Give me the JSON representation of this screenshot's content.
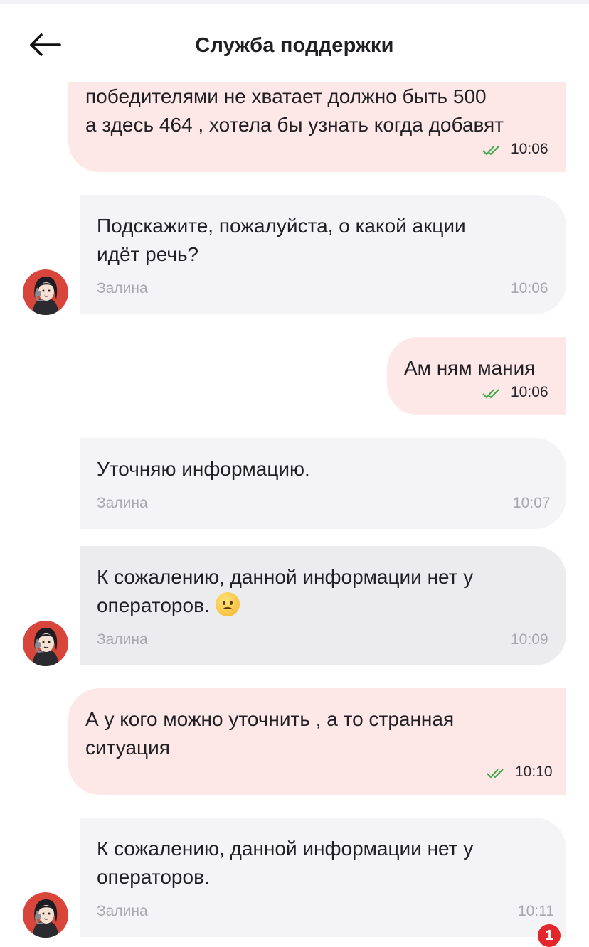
{
  "header": {
    "title": "Служба поддержки",
    "back_icon": "arrow-left-icon"
  },
  "messages": [
    {
      "direction": "out",
      "text": "победителями не хватает должно быть 500\nа здесь 464 , хотела бы узнать когда добавят",
      "time": "10:06",
      "status_icon": "double-check-icon"
    },
    {
      "direction": "in",
      "text": "Подскажите, пожалуйста, о какой акции\nидёт речь?",
      "sender": "Залина",
      "time": "10:06",
      "avatar": "operator-avatar-icon"
    },
    {
      "direction": "out",
      "text": "Ам ням мания",
      "time": "10:06",
      "status_icon": "double-check-icon"
    },
    {
      "direction": "in",
      "text": "Уточняю информацию.",
      "sender": "Залина",
      "time": "10:07"
    },
    {
      "direction": "in",
      "text": "К сожалению, данной информации нет у\nоператоров.",
      "emoji": "worried-face-emoji",
      "sender": "Залина",
      "time": "10:09",
      "avatar": "operator-avatar-icon"
    },
    {
      "direction": "out",
      "text": "А у кого можно уточнить , а то странная\nситуация",
      "time": "10:10",
      "status_icon": "double-check-icon"
    },
    {
      "direction": "in",
      "text": "К сожалению, данной информации нет у\nоператоров.",
      "sender": "Залина",
      "time": "10:11",
      "avatar": "operator-avatar-icon"
    }
  ],
  "unread_badge": "1",
  "colors": {
    "outgoing_bubble": "#fde7e7",
    "incoming_bubble": "#f4f4f6",
    "check_green": "#3aa845",
    "avatar_red": "#d8453a",
    "badge_red": "#e2262b"
  }
}
